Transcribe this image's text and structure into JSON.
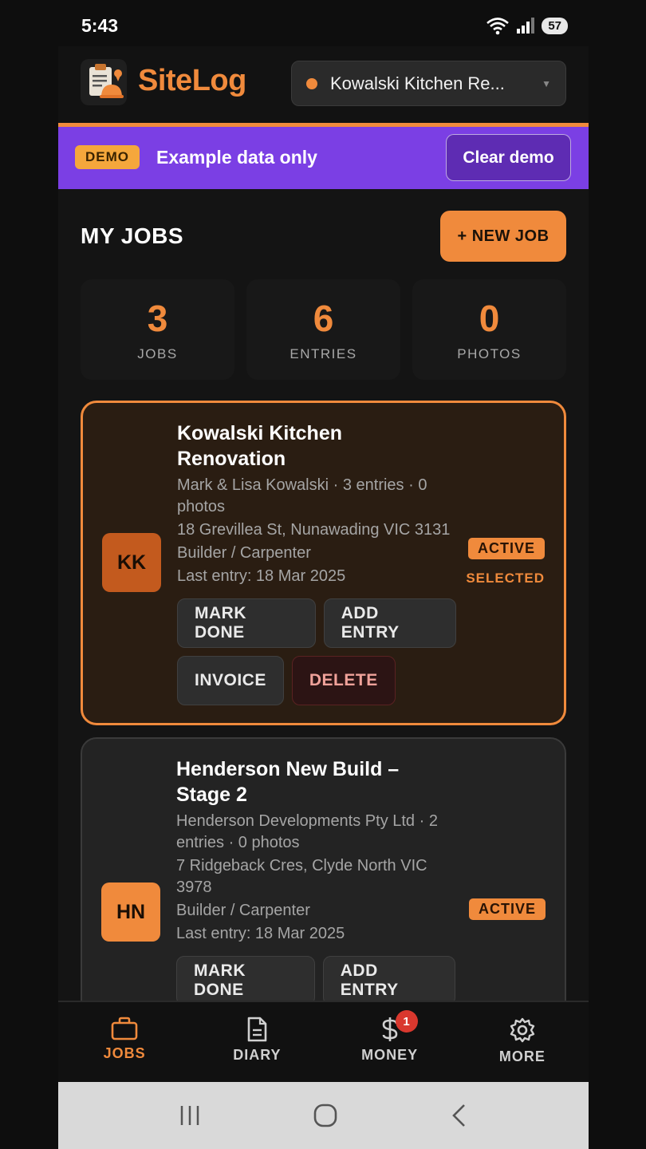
{
  "status": {
    "time": "5:43",
    "battery": "57"
  },
  "header": {
    "brand": "SiteLog",
    "selected_job": "Kowalski Kitchen Re..."
  },
  "demo": {
    "tag": "DEMO",
    "text": "Example data only",
    "clear_label": "Clear demo"
  },
  "jobs_section": {
    "title": "MY JOBS",
    "new_job_label": "+ NEW JOB"
  },
  "stats": [
    {
      "value": "3",
      "label": "JOBS"
    },
    {
      "value": "6",
      "label": "ENTRIES"
    },
    {
      "value": "0",
      "label": "PHOTOS"
    }
  ],
  "jobs": [
    {
      "initials": "KK",
      "title": "Kowalski Kitchen Renovation",
      "meta": "Mark & Lisa Kowalski · 3 entries · 0 photos",
      "address": "18 Grevillea St, Nunawading VIC 3131",
      "trade": "Builder / Carpenter",
      "last_entry": "Last entry: 18 Mar 2025",
      "status": "ACTIVE",
      "selected_label": "SELECTED",
      "actions": {
        "mark_done": "MARK DONE",
        "add_entry": "ADD ENTRY",
        "invoice": "INVOICE",
        "delete": "DELETE"
      }
    },
    {
      "initials": "HN",
      "title": "Henderson New Build – Stage 2",
      "meta": "Henderson Developments Pty Ltd · 2 entries · 0 photos",
      "address": "7 Ridgeback Cres, Clyde North VIC 3978",
      "trade": "Builder / Carpenter",
      "last_entry": "Last entry: 18 Mar 2025",
      "status": "ACTIVE",
      "actions": {
        "mark_done": "MARK DONE",
        "add_entry": "ADD ENTRY"
      }
    }
  ],
  "bottom_nav": [
    {
      "label": "JOBS",
      "icon": "briefcase-icon"
    },
    {
      "label": "DIARY",
      "icon": "document-icon"
    },
    {
      "label": "MONEY",
      "icon": "dollar-icon",
      "badge": "1"
    },
    {
      "label": "MORE",
      "icon": "gear-icon"
    }
  ],
  "colors": {
    "accent": "#f08a3c",
    "demo_banner": "#7b3fe4",
    "background": "#141414",
    "danger": "#f0a29a"
  }
}
